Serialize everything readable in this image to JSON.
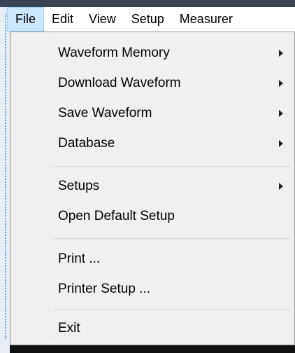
{
  "menubar": {
    "items": [
      {
        "label": "File"
      },
      {
        "label": "Edit"
      },
      {
        "label": "View"
      },
      {
        "label": "Setup"
      },
      {
        "label": "Measurer"
      }
    ]
  },
  "file_menu": {
    "items": [
      {
        "label": "Waveform Memory"
      },
      {
        "label": "Download Waveform"
      },
      {
        "label": "Save Waveform"
      },
      {
        "label": "Database"
      },
      {
        "label": "Setups"
      },
      {
        "label": "Open Default Setup"
      },
      {
        "label": "Print ..."
      },
      {
        "label": "Printer Setup ..."
      },
      {
        "label": "Exit"
      }
    ]
  }
}
